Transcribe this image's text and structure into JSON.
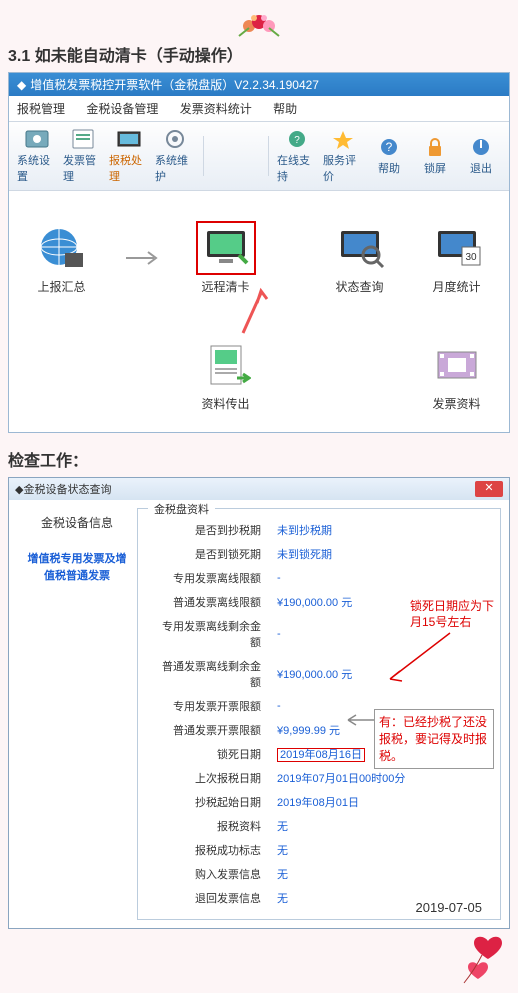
{
  "section1_title": "3.1 如未能自动清卡（手动操作）",
  "app": {
    "title": "增值税发票税控开票软件（金税盘版）V2.2.34.190427",
    "menus": [
      "报税管理",
      "金税设备管理",
      "发票资料统计",
      "帮助"
    ],
    "toolbar_left": [
      "系统设置",
      "发票管理",
      "报税处理",
      "系统维护"
    ],
    "toolbar_right": [
      "在线支持",
      "服务评价",
      "帮助",
      "锁屏",
      "退出"
    ],
    "grid": {
      "upload_summary": "上报汇总",
      "remote_clear": "远程清卡",
      "status_query": "状态查询",
      "monthly_stats": "月度统计",
      "data_transfer": "资料传出",
      "invoice_data": "发票资料"
    }
  },
  "section2_title": "检查工作：",
  "dialog": {
    "title": "金税设备状态查询",
    "left_title": "金税设备信息",
    "left_note": "增值税专用发票及增值税普通发票",
    "panel_title": "金税盘资料",
    "rows": [
      {
        "label": "是否到抄税期",
        "value": "未到抄税期"
      },
      {
        "label": "是否到锁死期",
        "value": "未到锁死期"
      },
      {
        "label": "专用发票离线限额",
        "value": "-"
      },
      {
        "label": "普通发票离线限额",
        "value": "¥190,000.00 元"
      },
      {
        "label": "专用发票离线剩余金额",
        "value": "-"
      },
      {
        "label": "普通发票离线剩余金额",
        "value": "¥190,000.00 元"
      },
      {
        "label": "专用发票开票限额",
        "value": "-"
      },
      {
        "label": "普通发票开票限额",
        "value": "¥9,999.99 元"
      },
      {
        "label": "锁死日期",
        "value": "2019年08月16日"
      },
      {
        "label": "上次报税日期",
        "value": "2019年07月01日00时00分"
      },
      {
        "label": "抄税起始日期",
        "value": "2019年08月01日"
      },
      {
        "label": "报税资料",
        "value": "无"
      },
      {
        "label": "报税成功标志",
        "value": "无"
      },
      {
        "label": "购入发票信息",
        "value": "无"
      },
      {
        "label": "退回发票信息",
        "value": "无"
      }
    ]
  },
  "anno": {
    "lock_note_l1": "锁死日期应为下",
    "lock_note_l2": "月15号左右",
    "callout": "有：已经抄税了还没报税，要记得及时报税。",
    "date": "2019-07-05"
  }
}
